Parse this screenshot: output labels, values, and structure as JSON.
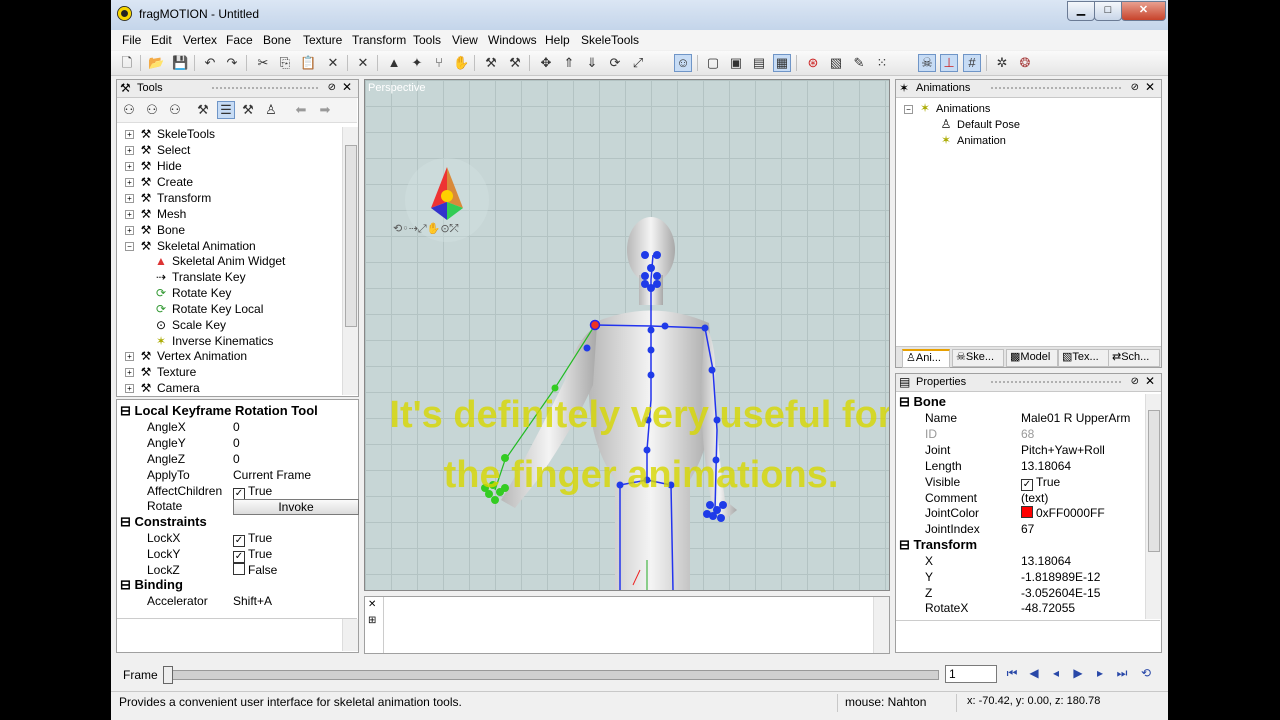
{
  "window": {
    "title": "fragMOTION - Untitled",
    "minimize": "▁",
    "maximize": "□",
    "close": "✕"
  },
  "menu": [
    "File",
    "Edit",
    "Vertex",
    "Face",
    "Bone",
    "Texture",
    "Transform",
    "Tools",
    "View",
    "Windows",
    "Help",
    "SkeleTools"
  ],
  "tools_panel": {
    "title": "Tools",
    "tree": [
      {
        "label": "SkeleTools",
        "level": 0,
        "exp": "+"
      },
      {
        "label": "Select",
        "level": 0,
        "exp": "+"
      },
      {
        "label": "Hide",
        "level": 0,
        "exp": "+"
      },
      {
        "label": "Create",
        "level": 0,
        "exp": "+"
      },
      {
        "label": "Transform",
        "level": 0,
        "exp": "+"
      },
      {
        "label": "Mesh",
        "level": 0,
        "exp": "+"
      },
      {
        "label": "Bone",
        "level": 0,
        "exp": "+"
      },
      {
        "label": "Skeletal Animation",
        "level": 0,
        "exp": "−"
      },
      {
        "label": "Skeletal Anim Widget",
        "level": 1,
        "exp": ""
      },
      {
        "label": "Translate Key",
        "level": 1,
        "exp": ""
      },
      {
        "label": "Rotate Key",
        "level": 1,
        "exp": ""
      },
      {
        "label": "Rotate Key Local",
        "level": 1,
        "exp": ""
      },
      {
        "label": "Scale Key",
        "level": 1,
        "exp": ""
      },
      {
        "label": "Inverse Kinematics",
        "level": 1,
        "exp": ""
      },
      {
        "label": "Vertex Animation",
        "level": 0,
        "exp": "+"
      },
      {
        "label": "Texture",
        "level": 0,
        "exp": "+"
      },
      {
        "label": "Camera",
        "level": 0,
        "exp": "+"
      }
    ]
  },
  "tool_props": {
    "section1": "Local Keyframe Rotation Tool",
    "angle_x": {
      "name": "AngleX",
      "value": "0"
    },
    "angle_y": {
      "name": "AngleY",
      "value": "0"
    },
    "angle_z": {
      "name": "AngleZ",
      "value": "0"
    },
    "apply_to": {
      "name": "ApplyTo",
      "value": "Current Frame"
    },
    "affect_children": {
      "name": "AffectChildren",
      "value": "True"
    },
    "rotate": {
      "name": "Rotate",
      "button": "Invoke"
    },
    "section2": "Constraints",
    "lock_x": {
      "name": "LockX",
      "value": "True"
    },
    "lock_y": {
      "name": "LockY",
      "value": "True"
    },
    "lock_z": {
      "name": "LockZ",
      "value": "False"
    },
    "section3": "Binding",
    "accelerator": {
      "name": "Accelerator",
      "value": "Shift+A"
    }
  },
  "viewport": {
    "label": "Perspective",
    "subtitle": "It's definitely very useful for the finger animations."
  },
  "animations_panel": {
    "title": "Animations",
    "root": "Animations",
    "items": [
      "Default Pose",
      "Animation"
    ],
    "tabs": [
      "Ani...",
      "Ske...",
      "Model",
      "Tex...",
      "Sch..."
    ]
  },
  "properties_panel": {
    "title": "Properties",
    "bone_section": "Bone",
    "bone": [
      {
        "name": "Name",
        "value": "Male01 R UpperArm"
      },
      {
        "name": "ID",
        "value": "68"
      },
      {
        "name": "Joint",
        "value": "Pitch+Yaw+Roll"
      },
      {
        "name": "Length",
        "value": "13.18064"
      },
      {
        "name": "Visible",
        "value": "True"
      },
      {
        "name": "Comment",
        "value": "(text)"
      },
      {
        "name": "JointColor",
        "value": "0xFF0000FF"
      },
      {
        "name": "JointIndex",
        "value": "67"
      }
    ],
    "transform_section": "Transform",
    "transform": [
      {
        "name": "X",
        "value": "13.18064"
      },
      {
        "name": "Y",
        "value": "-1.818989E-12"
      },
      {
        "name": "Z",
        "value": "-3.052604E-15"
      },
      {
        "name": "RotateX",
        "value": "-48.72055"
      }
    ],
    "joint_color_hex": "#ff0000"
  },
  "frame_bar": {
    "label": "Frame",
    "value": "1",
    "progress": 0
  },
  "status": {
    "message": "Provides a convenient user interface for skeletal animation tools.",
    "mouse": "mouse: Nahton",
    "coords": "x: -70.42, y: 0.00, z: 180.78"
  }
}
